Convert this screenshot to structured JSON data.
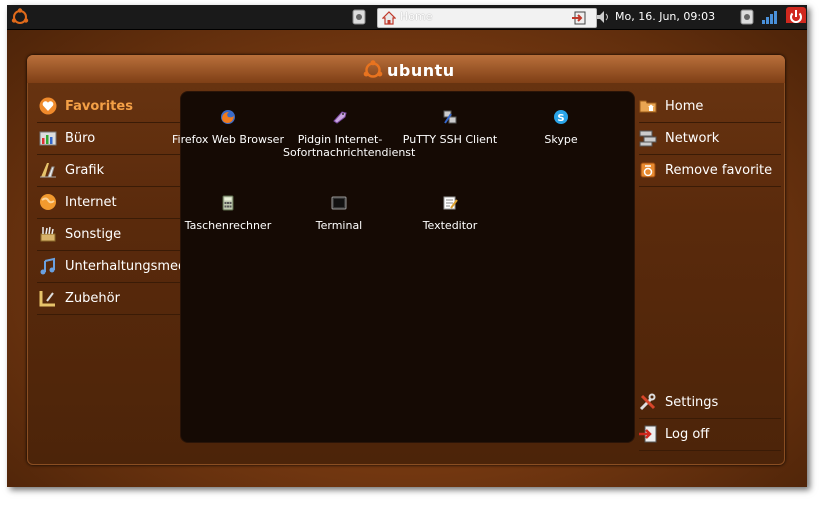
{
  "top_panel": {
    "window_title": "Home",
    "clock": "Mo, 16. Jun, 09:03"
  },
  "header": {
    "brand": "ubuntu"
  },
  "categories": [
    {
      "label": "Favorites",
      "icon": "heart-icon",
      "active": true
    },
    {
      "label": "Büro",
      "icon": "office-icon"
    },
    {
      "label": "Grafik",
      "icon": "graphics-icon"
    },
    {
      "label": "Internet",
      "icon": "globe-icon"
    },
    {
      "label": "Sonstige",
      "icon": "misc-icon"
    },
    {
      "label": "Unterhaltungsmedien",
      "icon": "music-icon"
    },
    {
      "label": "Zubehör",
      "icon": "accessories-icon"
    }
  ],
  "apps": [
    {
      "label": "Firefox Web Browser",
      "icon": "firefox-icon"
    },
    {
      "label": "Pidgin Internet-Sofortnachrichtendienst",
      "icon": "pidgin-icon"
    },
    {
      "label": "PuTTY SSH Client",
      "icon": "putty-icon"
    },
    {
      "label": "Skype",
      "icon": "skype-icon"
    },
    {
      "label": "Taschenrechner",
      "icon": "calculator-icon"
    },
    {
      "label": "Terminal",
      "icon": "terminal-icon"
    },
    {
      "label": "Texteditor",
      "icon": "text-editor-icon"
    }
  ],
  "places": [
    {
      "label": "Home",
      "icon": "home-folder-icon"
    },
    {
      "label": "Network",
      "icon": "network-icon"
    },
    {
      "label": "Remove favorite",
      "icon": "remove-favorite-icon"
    }
  ],
  "system": [
    {
      "label": "Settings",
      "icon": "settings-icon"
    },
    {
      "label": "Log off",
      "icon": "log-off-icon"
    }
  ],
  "colors": {
    "accent": "#f4a046",
    "background": "#7a3b12",
    "panel": "#150a04"
  }
}
